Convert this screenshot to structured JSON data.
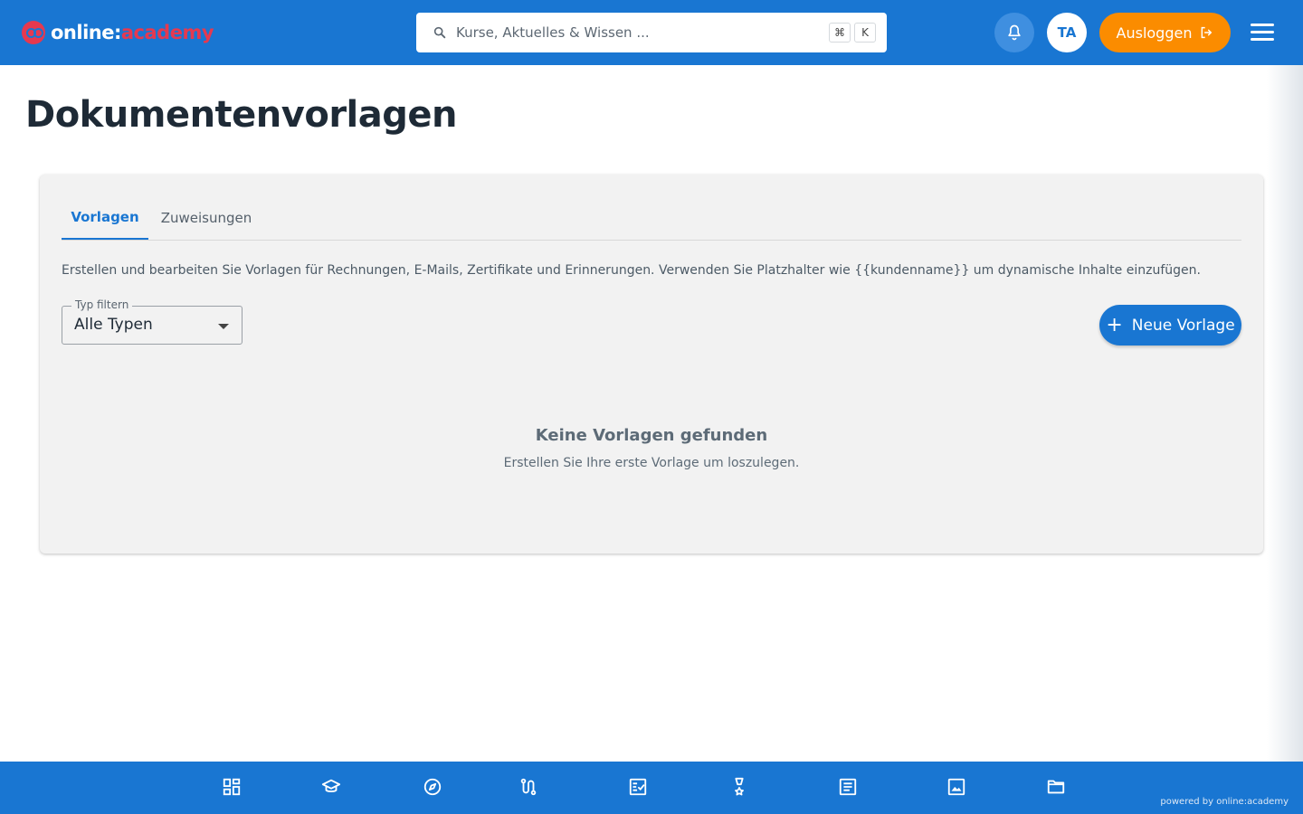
{
  "header": {
    "logo": {
      "part1": "online:",
      "part2": "academy"
    },
    "search": {
      "placeholder": "Kurse, Aktuelles & Wissen ...",
      "shortcut_key1": "⌘",
      "shortcut_key2": "K"
    },
    "avatar_initials": "TA",
    "logout_label": "Ausloggen"
  },
  "page": {
    "title": "Dokumentenvorlagen"
  },
  "tabs": [
    {
      "label": "Vorlagen",
      "active": true
    },
    {
      "label": "Zuweisungen",
      "active": false
    }
  ],
  "description": "Erstellen und bearbeiten Sie Vorlagen für Rechnungen, E-Mails, Zertifikate und Erinnerungen. Verwenden Sie Platzhalter wie {{kundenname}} um dynamische Inhalte einzufügen.",
  "filter": {
    "label": "Typ filtern",
    "value": "Alle Typen"
  },
  "new_button_label": "Neue Vorlage",
  "empty_state": {
    "title": "Keine Vorlagen gefunden",
    "subtitle": "Erstellen Sie Ihre erste Vorlage um loszulegen."
  },
  "bottom_nav": {
    "icons": [
      "dashboard-icon",
      "graduation-cap-icon",
      "compass-icon",
      "route-icon",
      "checklist-icon",
      "award-icon",
      "article-icon",
      "image-icon",
      "folder-icon"
    ]
  },
  "footer": {
    "powered_by": "powered by online:academy"
  },
  "colors": {
    "primary": "#1976d2",
    "logout": "#fb8c00",
    "brand_red": "#e53950"
  }
}
